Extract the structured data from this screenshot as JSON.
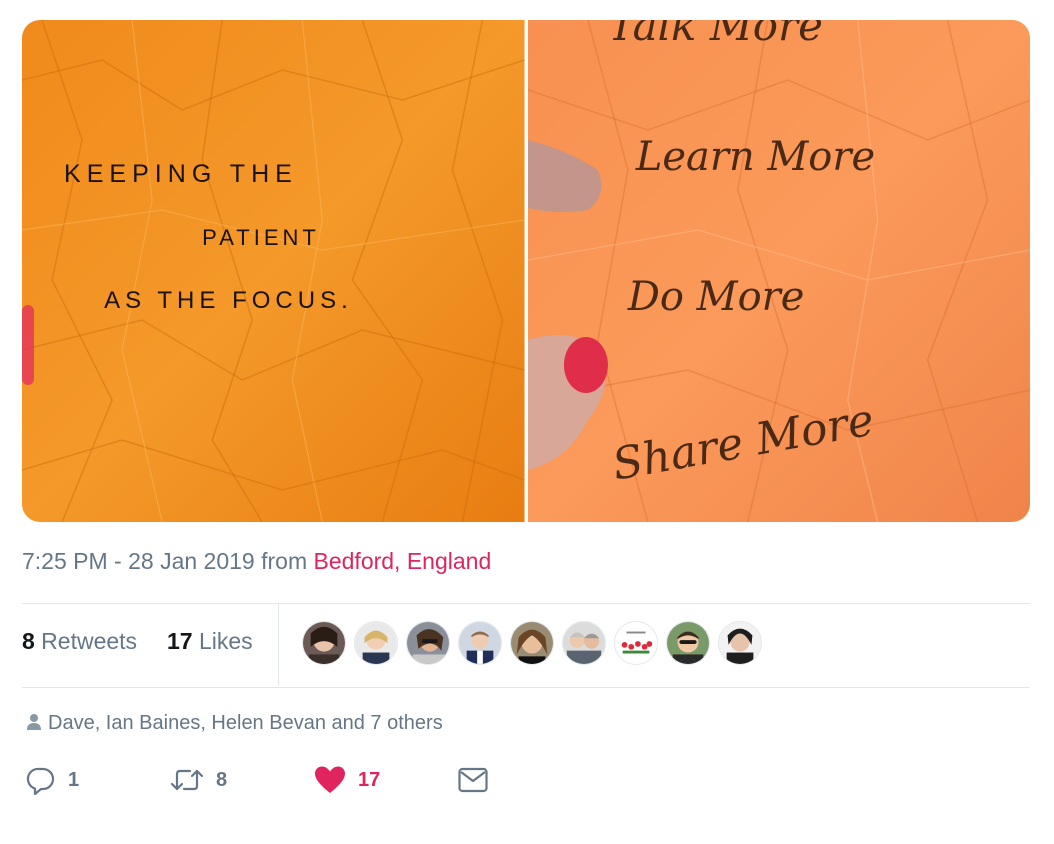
{
  "photos": [
    {
      "alt": "Crumpled orange paper with handwritten text",
      "lines": [
        "KEEPING   THE",
        "PATIENT",
        "AS   THE   FOCUS."
      ]
    },
    {
      "alt": "Crumpled orange paper with handwritten text",
      "lines": [
        "Talk More",
        "Learn More",
        "Do More",
        "Share More"
      ]
    }
  ],
  "tweet": {
    "timestamp": "7:25 PM - 28 Jan 2019",
    "from_word": " from ",
    "location": "Bedford, England"
  },
  "stats": {
    "retweets_count": "8",
    "retweets_label": " Retweets",
    "likes_count": "17",
    "likes_label": " Likes"
  },
  "liked_by": {
    "text": "Dave, Ian Baines, Helen Bevan and 7 others",
    "avatar_count": 9
  },
  "actions": {
    "reply_count": "1",
    "retweet_count": "8",
    "like_count": "17"
  },
  "colors": {
    "accent": "#e0245e",
    "muted": "#657786",
    "divider": "#e1e8ed"
  }
}
